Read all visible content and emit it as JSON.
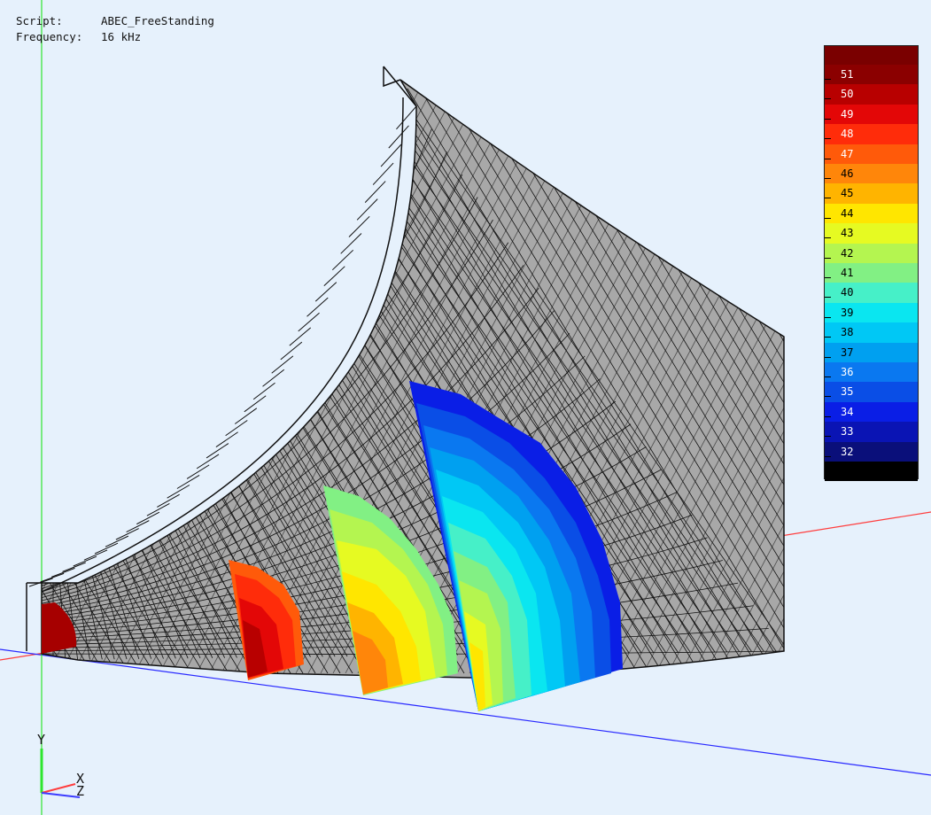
{
  "info": {
    "script_label": "Script:",
    "script_value": "ABEC_FreeStanding",
    "frequency_label": "Frequency:",
    "frequency_value": "16 kHz"
  },
  "legend": {
    "levels": [
      {
        "value": "51",
        "color": "#8b0000",
        "text_color": "#ffffff"
      },
      {
        "value": "50",
        "color": "#b80000",
        "text_color": "#ffffff"
      },
      {
        "value": "49",
        "color": "#e30707",
        "text_color": "#ffffff"
      },
      {
        "value": "48",
        "color": "#ff2c0a",
        "text_color": "#ffffff"
      },
      {
        "value": "47",
        "color": "#ff5a0a",
        "text_color": "#ffffff"
      },
      {
        "value": "46",
        "color": "#ff860a",
        "text_color": "#000000"
      },
      {
        "value": "45",
        "color": "#ffb400",
        "text_color": "#000000"
      },
      {
        "value": "44",
        "color": "#ffe600",
        "text_color": "#000000"
      },
      {
        "value": "43",
        "color": "#e6fa22",
        "text_color": "#000000"
      },
      {
        "value": "42",
        "color": "#b4f550",
        "text_color": "#000000"
      },
      {
        "value": "41",
        "color": "#82f084",
        "text_color": "#000000"
      },
      {
        "value": "40",
        "color": "#46f0c8",
        "text_color": "#000000"
      },
      {
        "value": "39",
        "color": "#0ae6f0",
        "text_color": "#000000"
      },
      {
        "value": "38",
        "color": "#00c8f5",
        "text_color": "#000000"
      },
      {
        "value": "37",
        "color": "#00a0f0",
        "text_color": "#000000"
      },
      {
        "value": "36",
        "color": "#0a78f0",
        "text_color": "#ffffff"
      },
      {
        "value": "35",
        "color": "#0a4ee6",
        "text_color": "#ffffff"
      },
      {
        "value": "34",
        "color": "#0a1ee6",
        "text_color": "#ffffff"
      },
      {
        "value": "33",
        "color": "#0a14b4",
        "text_color": "#ffffff"
      },
      {
        "value": "32",
        "color": "#0a0f7a",
        "text_color": "#ffffff"
      }
    ],
    "top_color": "#7a0000",
    "bottom_color": "#000000"
  },
  "axes": {
    "y_label": "Y",
    "x_label": "X",
    "z_label": "Z",
    "x_color": "#ff3c3c",
    "y_color": "#3ce63c",
    "z_color": "#3c3cff"
  },
  "scene": {
    "mesh_fill": "#a6a6a6",
    "mesh_line": "#111111"
  }
}
